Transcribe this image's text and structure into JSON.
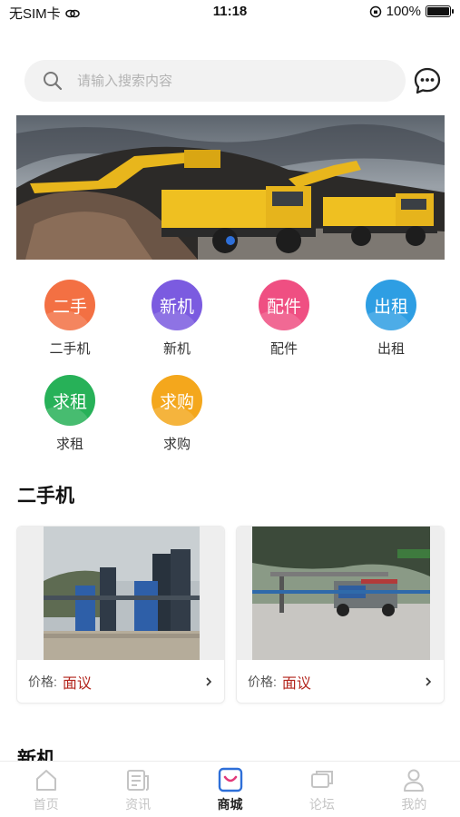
{
  "status_bar": {
    "carrier": "无SIM卡",
    "time": "11:18",
    "battery": "100%",
    "battery_level": 1.0
  },
  "search": {
    "placeholder": "请输入搜索内容",
    "value": ""
  },
  "categories": [
    {
      "label": "二手机",
      "icon_text": "二手",
      "color": "#f37043"
    },
    {
      "label": "新机",
      "icon_text": "新机",
      "color": "#7b5be0"
    },
    {
      "label": "配件",
      "icon_text": "配件",
      "color": "#ef4f82"
    },
    {
      "label": "出租",
      "icon_text": "出租",
      "color": "#2e9ee3"
    },
    {
      "label": "求租",
      "icon_text": "求租",
      "color": "#27b158"
    },
    {
      "label": "求购",
      "icon_text": "求购",
      "color": "#f4a71c"
    }
  ],
  "sections": {
    "used": {
      "title": "二手机"
    },
    "new": {
      "title": "新机"
    }
  },
  "listings": [
    {
      "price_label": "价格:",
      "price_value": "面议"
    },
    {
      "price_label": "价格:",
      "price_value": "面议"
    }
  ],
  "tabs": [
    {
      "label": "首页",
      "icon": "home-icon",
      "active": false
    },
    {
      "label": "资讯",
      "icon": "news-icon",
      "active": false
    },
    {
      "label": "商城",
      "icon": "mall-icon",
      "active": true
    },
    {
      "label": "论坛",
      "icon": "forum-icon",
      "active": false
    },
    {
      "label": "我的",
      "icon": "profile-icon",
      "active": false
    }
  ],
  "colors": {
    "accent": "#2e6fd8",
    "price": "#b3261e",
    "tab_inactive": "#c4c4c4"
  }
}
